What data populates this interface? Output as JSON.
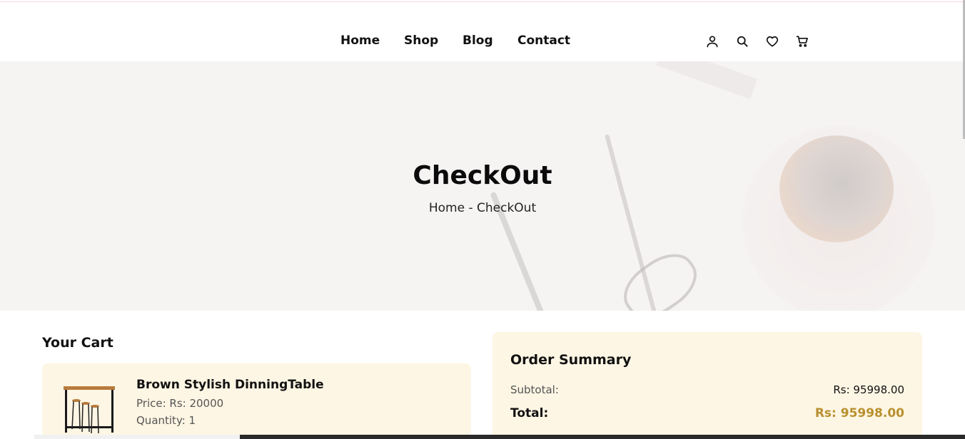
{
  "nav": {
    "items": [
      {
        "label": "Home"
      },
      {
        "label": "Shop"
      },
      {
        "label": "Blog"
      },
      {
        "label": "Contact"
      }
    ],
    "icons": [
      "user-icon",
      "search-icon",
      "heart-icon",
      "cart-icon"
    ]
  },
  "hero": {
    "title": "CheckOut",
    "breadcrumb": "Home - CheckOut"
  },
  "cart": {
    "heading": "Your Cart",
    "items": [
      {
        "name": "Brown Stylish DinningTable",
        "price": "Price: Rs: 20000",
        "quantity": "Quantity: 1",
        "image_icon": "dining-table-image"
      }
    ]
  },
  "summary": {
    "title": "Order Summary",
    "subtotal_label": "Subtotal:",
    "subtotal_value": "Rs: 95998.00",
    "total_label": "Total:",
    "total_value": "Rs: 95998.00"
  },
  "colors": {
    "card_bg": "#fef6e4",
    "hero_bg": "#f6f3f3",
    "accent": "#b8902f"
  }
}
